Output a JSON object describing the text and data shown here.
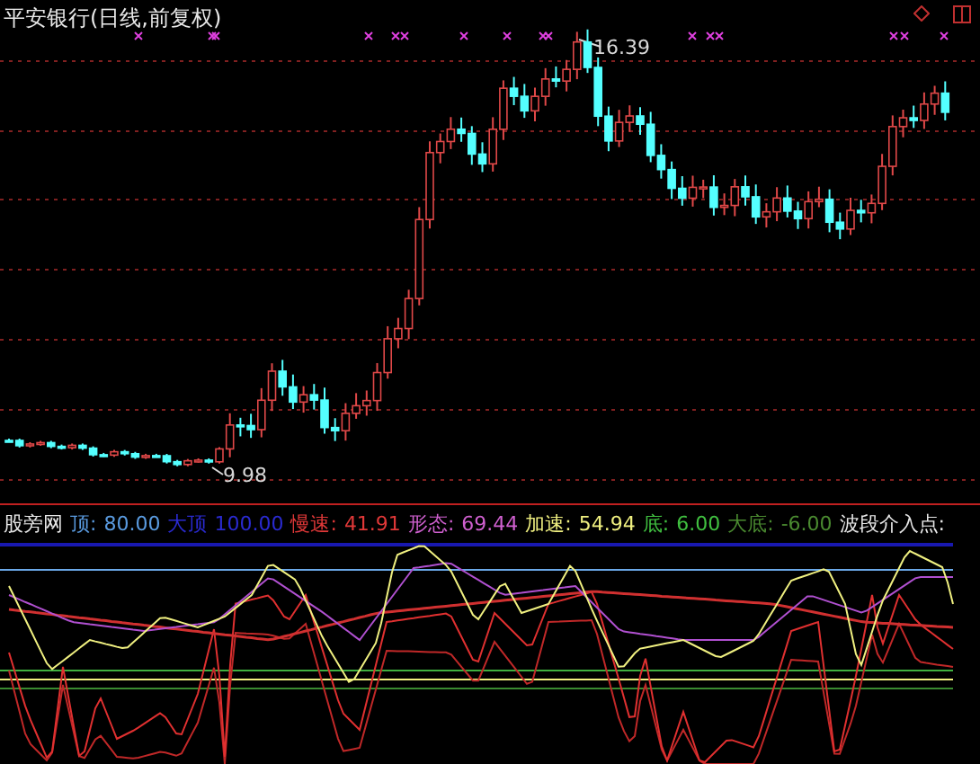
{
  "title": "平安银行(日线,前复权)",
  "price_labels": [
    {
      "kind": "high",
      "text": "16.39"
    },
    {
      "kind": "low",
      "text": "9.98"
    }
  ],
  "indicator": {
    "name": "股旁网",
    "values": [
      {
        "label": "顶:",
        "value": "80.00",
        "color": "#5a9be0"
      },
      {
        "label": "大顶",
        "value": "100.00",
        "color": "#2a2ad0"
      },
      {
        "label": "慢速:",
        "value": "41.91",
        "color": "#e03838"
      },
      {
        "label": "形态:",
        "value": "69.44",
        "color": "#d060d0"
      },
      {
        "label": "加速:",
        "value": "54.94",
        "color": "#f0f080"
      },
      {
        "label": "底:",
        "value": "6.00",
        "color": "#40c040"
      },
      {
        "label": "大底:",
        "value": "-6.00",
        "color": "#4a8a30"
      }
    ],
    "signal_label": "波段介入点:"
  }
}
